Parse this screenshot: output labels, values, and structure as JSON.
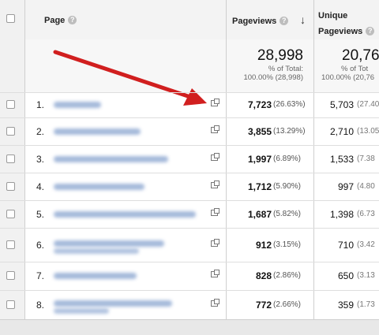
{
  "header": {
    "page_label": "Page",
    "help_glyph": "?",
    "pageviews_label": "Pageviews",
    "sort_glyph": "↓",
    "unique_line1": "Unique",
    "unique_line2": "Pageviews"
  },
  "totals": {
    "pageviews": "28,998",
    "pageviews_pct_label": "% of Total:",
    "pageviews_pct_value": "100.00% (28,998)",
    "unique": "20,76",
    "unique_pct_label": "% of Tot",
    "unique_pct_value": "100.00% (20,76"
  },
  "rows": [
    {
      "index": "1.",
      "pageviews": "7,723",
      "pageviews_pct": "(26.63%)",
      "unique": "5,703",
      "unique_pct": "(27.40"
    },
    {
      "index": "2.",
      "pageviews": "3,855",
      "pageviews_pct": "(13.29%)",
      "unique": "2,710",
      "unique_pct": "(13.05"
    },
    {
      "index": "3.",
      "pageviews": "1,997",
      "pageviews_pct": "(6.89%)",
      "unique": "1,533",
      "unique_pct": "(7.38"
    },
    {
      "index": "4.",
      "pageviews": "1,712",
      "pageviews_pct": "(5.90%)",
      "unique": "997",
      "unique_pct": "(4.80"
    },
    {
      "index": "5.",
      "pageviews": "1,687",
      "pageviews_pct": "(5.82%)",
      "unique": "1,398",
      "unique_pct": "(6.73"
    },
    {
      "index": "6.",
      "pageviews": "912",
      "pageviews_pct": "(3.15%)",
      "unique": "710",
      "unique_pct": "(3.42"
    },
    {
      "index": "7.",
      "pageviews": "828",
      "pageviews_pct": "(2.86%)",
      "unique": "650",
      "unique_pct": "(3.13"
    },
    {
      "index": "8.",
      "pageviews": "772",
      "pageviews_pct": "(2.66%)",
      "unique": "359",
      "unique_pct": "(1.73"
    }
  ],
  "colors": {
    "arrow": "#d11f1f",
    "blurred_link": "#9fb5d8"
  },
  "icons": {
    "help": "help-icon",
    "external": "external-link-icon",
    "sort": "sort-desc-icon"
  }
}
